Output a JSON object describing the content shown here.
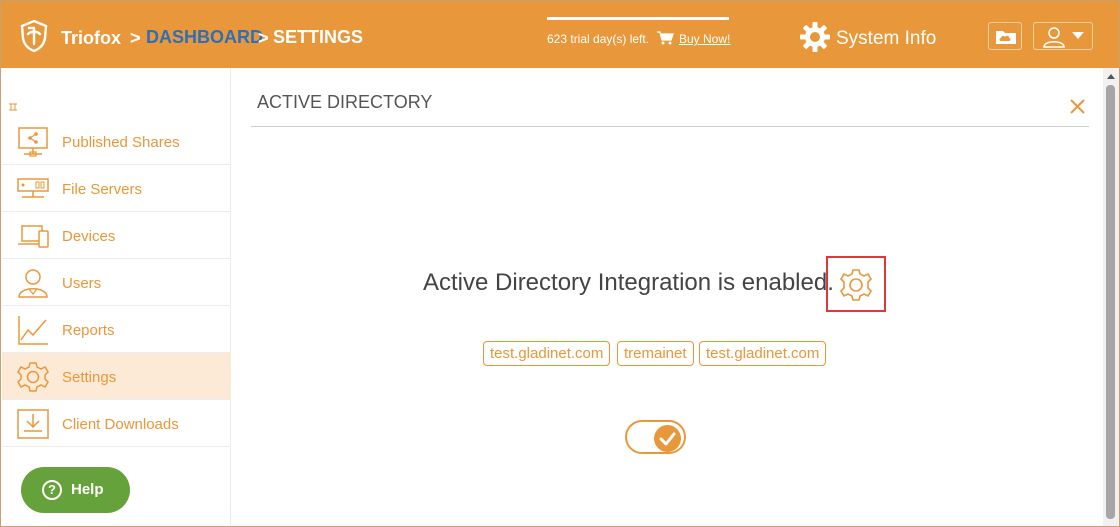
{
  "header": {
    "brand": "Triofox",
    "separator_1": ">",
    "breadcrumb_dashboard": "DASHBOARD",
    "separator_2": ">",
    "breadcrumb_settings": "SETTINGS",
    "trial_text": "623 trial day(s) left.",
    "buy_now": "Buy Now!",
    "system_info": "System Info",
    "icons": [
      "shield-logo-icon",
      "cart-icon",
      "gear-icon",
      "cloud-folder-icon",
      "user-icon",
      "caret-down-icon"
    ]
  },
  "sidebar": {
    "items": [
      {
        "label": "Published Shares",
        "icon": "share-monitor-icon",
        "active": false
      },
      {
        "label": "File Servers",
        "icon": "server-icon",
        "active": false
      },
      {
        "label": "Devices",
        "icon": "devices-icon",
        "active": false
      },
      {
        "label": "Users",
        "icon": "user-icon",
        "active": false
      },
      {
        "label": "Reports",
        "icon": "chart-icon",
        "active": false
      },
      {
        "label": "Settings",
        "icon": "gear-icon",
        "active": true
      },
      {
        "label": "Client Downloads",
        "icon": "download-icon",
        "active": false
      }
    ],
    "help_label": "Help",
    "help_glyph": "?"
  },
  "main": {
    "title": "ACTIVE DIRECTORY",
    "status": "Active Directory Integration is enabled.",
    "domains": [
      "test.gladinet.com",
      "tremainet",
      "test.gladinet.com"
    ],
    "toggle_enabled": true
  },
  "colors": {
    "accent": "#e8983a",
    "breadcrumb_link": "#2f6fb6",
    "help_button": "#66a23b",
    "active_item_bg": "#fce9d6",
    "highlight": "#e0383a"
  }
}
